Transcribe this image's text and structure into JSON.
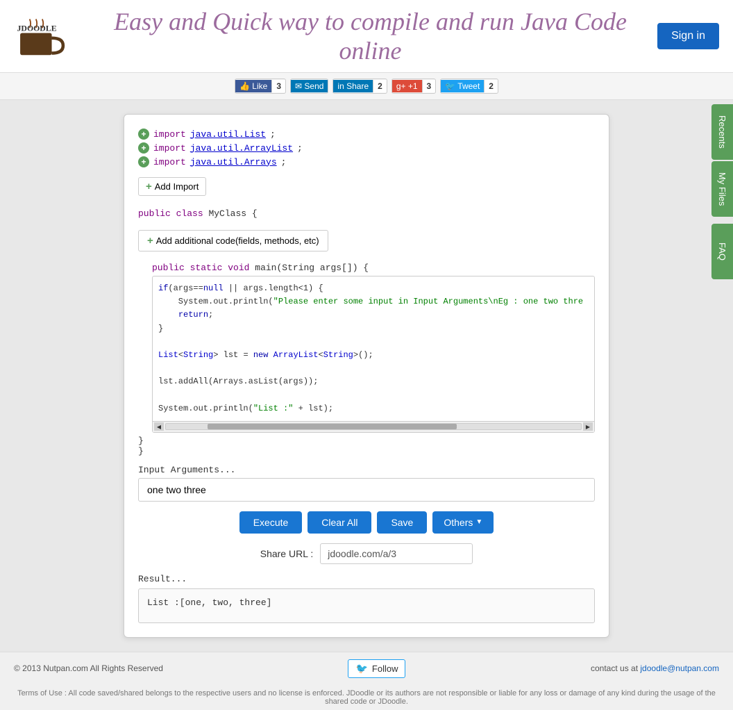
{
  "header": {
    "tagline": "Easy and Quick way to compile and run Java Code online",
    "sign_in_label": "Sign in"
  },
  "social": {
    "facebook": {
      "label": "Like",
      "count": "3"
    },
    "send": {
      "label": "Send",
      "count": ""
    },
    "linkedin": {
      "label": "Share",
      "count": "2"
    },
    "gplus": {
      "label": "+1",
      "count": "3"
    },
    "twitter": {
      "label": "Tweet",
      "count": "2"
    }
  },
  "sidebar": {
    "recents_label": "Recents",
    "myfiles_label": "My Files",
    "faq_label": "FAQ"
  },
  "editor": {
    "imports": [
      {
        "keyword": "import",
        "class": "java.util.List",
        "semi": ";"
      },
      {
        "keyword": "import",
        "class": "java.util.ArrayList",
        "semi": ";"
      },
      {
        "keyword": "import",
        "class": "java.util.Arrays",
        "semi": ";"
      }
    ],
    "add_import_label": "Add Import",
    "class_decl": "public class MyClass {",
    "add_code_label": "Add additional code(fields, methods, etc)",
    "method_decl": "public static void main(String args[]) {",
    "code_lines": [
      "if(args==null || args.length<1) {",
      "    System.out.println(\"Please enter some input in Input Arguments\\nEg : one two thre",
      "    return;",
      "}"
    ],
    "code_lines2": [
      "List<String> lst = new ArrayList<String>();",
      "",
      "lst.addAll(Arrays.asList(args));",
      "",
      "System.out.println(\"List :\" + lst);"
    ],
    "closing_inner": "  }",
    "closing_outer": "}",
    "input_label": "Input Arguments...",
    "input_value": "one two three",
    "input_placeholder": "one two three"
  },
  "buttons": {
    "execute_label": "Execute",
    "clear_all_label": "Clear All",
    "save_label": "Save",
    "others_label": "Others"
  },
  "share": {
    "label": "Share URL :",
    "value": "jdoodle.com/a/3"
  },
  "result": {
    "label": "Result...",
    "value": "List :[one, two, three]"
  },
  "footer": {
    "copyright": "© 2013 Nutpan.com All Rights Reserved",
    "follow_label": "Follow",
    "contact_prefix": "contact us at",
    "contact_email": "jdoodle@nutpan.com",
    "terms": "Terms of Use : All code saved/shared belongs to the respective users and no license is enforced. JDoodle or its authors are not responsible or liable for any loss or damage of any kind during the usage of the shared code or JDoodle."
  }
}
